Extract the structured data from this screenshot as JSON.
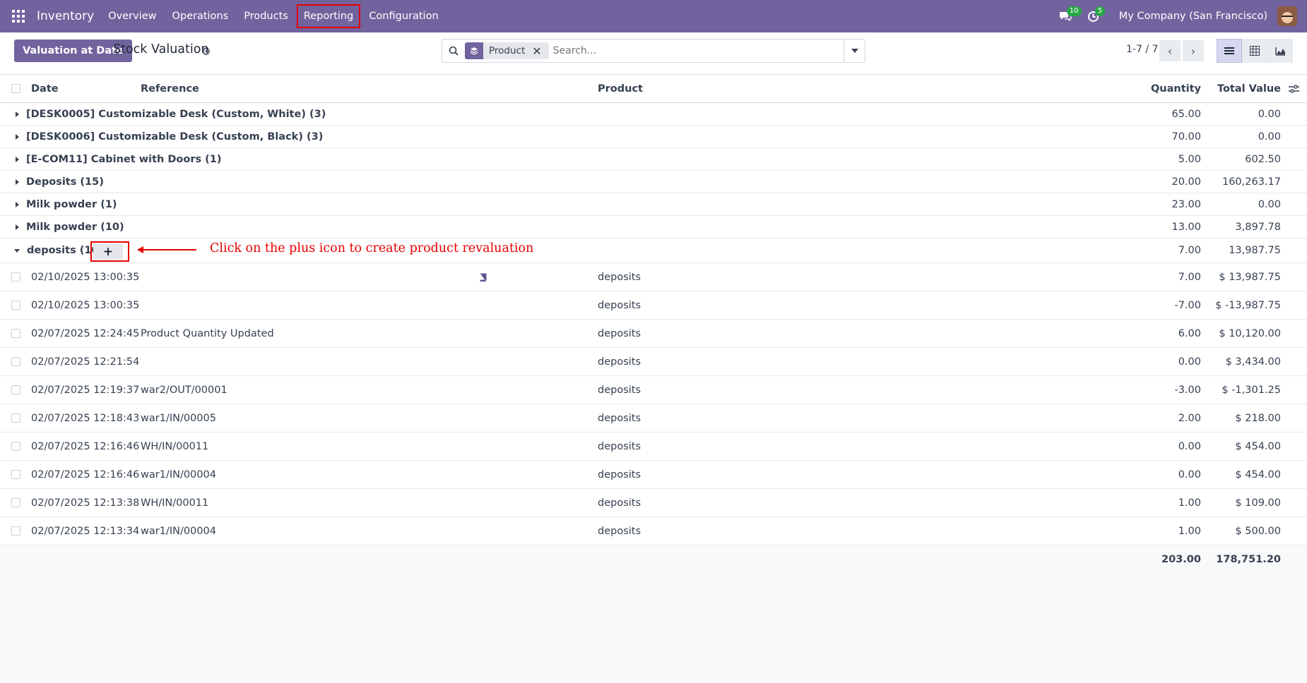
{
  "navbar": {
    "app_name": "Inventory",
    "menu": [
      "Overview",
      "Operations",
      "Products",
      "Reporting",
      "Configuration"
    ],
    "highlighted_menu": "Reporting",
    "messages_badge": "10",
    "activities_badge": "5",
    "company": "My Company (San Francisco)"
  },
  "control": {
    "primary_button": "Valuation at Date",
    "title": "Stock Valuation",
    "facet_label": "Product",
    "search_placeholder": "Search...",
    "pager": "1-7 / 7"
  },
  "table": {
    "headers": {
      "date": "Date",
      "reference": "Reference",
      "product": "Product",
      "quantity": "Quantity",
      "total_value": "Total Value"
    },
    "groups": [
      {
        "name": "[DESK0005] Customizable Desk (Custom, White) (3)",
        "quantity": "65.00",
        "total": "0.00"
      },
      {
        "name": "[DESK0006] Customizable Desk (Custom, Black) (3)",
        "quantity": "70.00",
        "total": "0.00"
      },
      {
        "name": "[E-COM11] Cabinet with Doors (1)",
        "quantity": "5.00",
        "total": "602.50"
      },
      {
        "name": "Deposits (15)",
        "quantity": "20.00",
        "total": "160,263.17"
      },
      {
        "name": "Milk powder (1)",
        "quantity": "23.00",
        "total": "0.00"
      },
      {
        "name": "Milk powder (10)",
        "quantity": "13.00",
        "total": "3,897.78"
      }
    ],
    "open_group": {
      "name": "deposits (10)",
      "quantity": "7.00",
      "total": "13,987.75",
      "add_label": "+"
    },
    "rows": [
      {
        "date": "02/10/2025 13:00:35",
        "reference": "",
        "product": "deposits",
        "quantity": "7.00",
        "total": "$ 13,987.75"
      },
      {
        "date": "02/10/2025 13:00:35",
        "reference": "",
        "product": "deposits",
        "quantity": "-7.00",
        "total": "$ -13,987.75"
      },
      {
        "date": "02/07/2025 12:24:45",
        "reference": "Product Quantity Updated",
        "product": "deposits",
        "quantity": "6.00",
        "total": "$ 10,120.00"
      },
      {
        "date": "02/07/2025 12:21:54",
        "reference": "",
        "product": "deposits",
        "quantity": "0.00",
        "total": "$ 3,434.00"
      },
      {
        "date": "02/07/2025 12:19:37",
        "reference": "war2/OUT/00001",
        "product": "deposits",
        "quantity": "-3.00",
        "total": "$ -1,301.25"
      },
      {
        "date": "02/07/2025 12:18:43",
        "reference": "war1/IN/00005",
        "product": "deposits",
        "quantity": "2.00",
        "total": "$ 218.00"
      },
      {
        "date": "02/07/2025 12:16:46",
        "reference": "WH/IN/00011",
        "product": "deposits",
        "quantity": "0.00",
        "total": "$ 454.00"
      },
      {
        "date": "02/07/2025 12:16:46",
        "reference": "war1/IN/00004",
        "product": "deposits",
        "quantity": "0.00",
        "total": "$ 454.00"
      },
      {
        "date": "02/07/2025 12:13:38",
        "reference": "WH/IN/00011",
        "product": "deposits",
        "quantity": "1.00",
        "total": "$ 109.00"
      },
      {
        "date": "02/07/2025 12:13:34",
        "reference": "war1/IN/00004",
        "product": "deposits",
        "quantity": "1.00",
        "total": "$ 500.00"
      }
    ],
    "footer": {
      "quantity": "203.00",
      "total": "178,751.20"
    }
  },
  "annotation": {
    "text": "Click on the plus icon to create product revaluation",
    "color": "#e60000"
  },
  "colors": {
    "brand": "#71639e",
    "badge": "#28a745"
  }
}
